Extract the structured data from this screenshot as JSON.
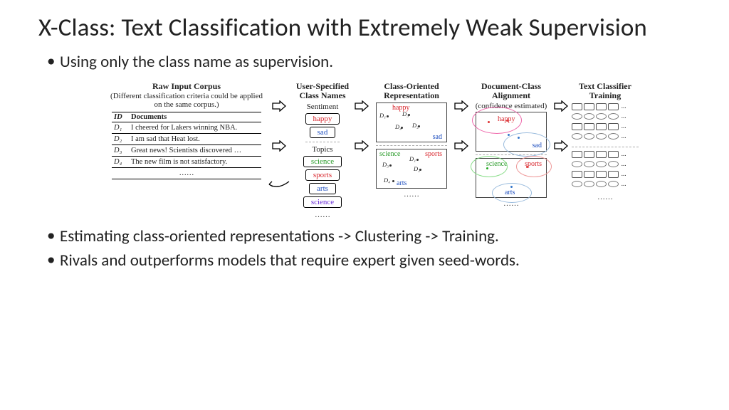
{
  "title": "X-Class: Text Classification with Extremely Weak Supervision",
  "bullets": [
    "Using only the class name as supervision.",
    "Estimating class-oriented representations -> Clustering -> Training.",
    "Rivals and outperforms models that require expert given seed-words."
  ],
  "figure": {
    "corpus": {
      "header": "Raw Input Corpus",
      "sub": "(Different classification criteria could be applied on the same corpus.)",
      "th_id": "ID",
      "th_doc": "Documents",
      "rows": [
        {
          "id": "D₁",
          "doc": "I cheered for Lakers winning NBA."
        },
        {
          "id": "D₂",
          "doc": "I am sad that Heat lost."
        },
        {
          "id": "D₃",
          "doc": "Great news! Scientists discovered …"
        },
        {
          "id": "D₄",
          "doc": "The new film is not satisfactory."
        }
      ],
      "row_dots": "……"
    },
    "class_names": {
      "header": "User-Specified Class Names",
      "group1": {
        "label": "Sentiment",
        "items": [
          "happy",
          "sad"
        ]
      },
      "group2": {
        "label": "Topics",
        "items": [
          "science",
          "sports",
          "arts",
          "science"
        ]
      },
      "ell": "……"
    },
    "rep": {
      "header": "Class-Oriented Representation",
      "top": {
        "labels": [
          "happy",
          "sad"
        ],
        "dpts": [
          "D₁",
          "D₃",
          "D₄",
          "D₂"
        ]
      },
      "bot": {
        "labels": [
          "science",
          "sports",
          "arts"
        ],
        "dpts": [
          "D₁",
          "D₂",
          "D₃",
          "D₄"
        ]
      },
      "ell": "……"
    },
    "align": {
      "header": "Document-Class Alignment",
      "sub": "(confidence estimated)",
      "top": {
        "labels": [
          "happy",
          "sad"
        ]
      },
      "bot": {
        "labels": [
          "science",
          "sports",
          "arts"
        ]
      },
      "ell": "……"
    },
    "train": {
      "header": "Text Classifier Training",
      "ell": "……",
      "dots": "…"
    }
  }
}
